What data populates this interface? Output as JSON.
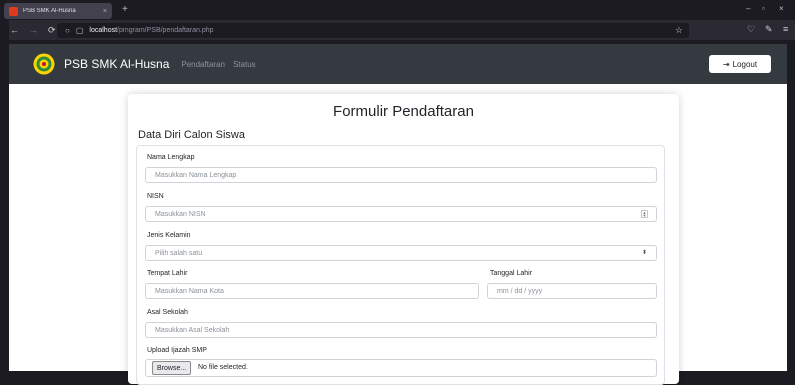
{
  "browser": {
    "tab_title": "PSB SMK Al-Husna",
    "tab_close": "×",
    "new_tab": "+",
    "url_host": "localhost",
    "url_path": "/pmgram/PSB/pendaftaran.php",
    "win_min": "–",
    "win_max": "▫",
    "win_close": "×"
  },
  "site": {
    "brand": "PSB SMK Al-Husna",
    "nav_links": [
      "Pendaftaran",
      "Status"
    ],
    "logout_label": "Logout",
    "colors": {
      "navbar": "#343a40",
      "brand": "#ffffff",
      "logo_ring": "#ffd400"
    }
  },
  "form": {
    "title": "Formulir Pendaftaran",
    "section_title": "Data Diri Calon Siswa",
    "nama": {
      "label": "Nama Lengkap",
      "placeholder": "Masukkan Nama Lengkap"
    },
    "nisn": {
      "label": "NISN",
      "placeholder": "Masukkan NISN"
    },
    "jenis_kelamin": {
      "label": "Jenis Kelamin",
      "selected": "Pilih salah satu"
    },
    "tempat_lahir": {
      "label": "Tempat Lahir",
      "placeholder": "Masukkan Nama Kota"
    },
    "tanggal_lahir": {
      "label": "Tanggal Lahir",
      "placeholder": "mm / dd / yyyy"
    },
    "asal_sekolah": {
      "label": "Asal Sekolah",
      "placeholder": "Masukkan Asal Sekolah"
    },
    "ijazah": {
      "label": "Upload Ijazah SMP",
      "browse_label": "Browse...",
      "status": "No file selected."
    }
  }
}
